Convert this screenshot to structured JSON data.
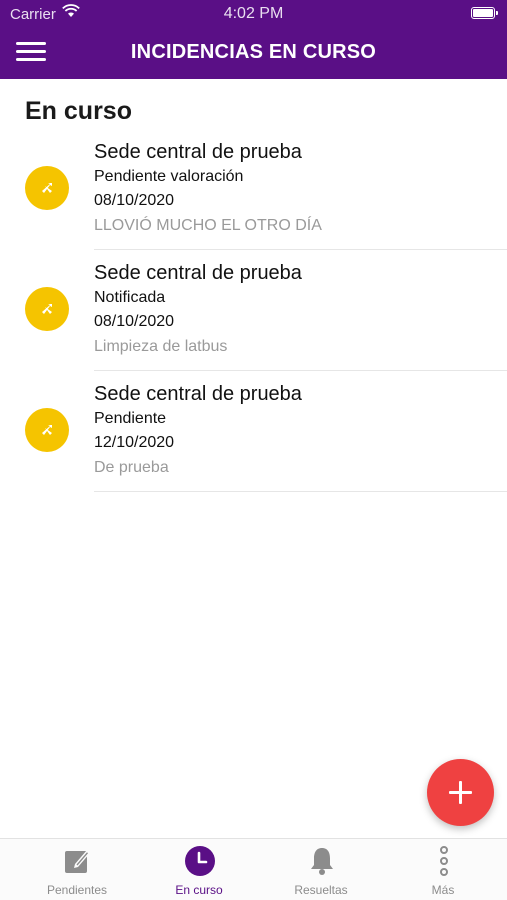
{
  "status_bar": {
    "carrier": "Carrier",
    "time": "4:02 PM"
  },
  "header": {
    "title": "INCIDENCIAS EN CURSO",
    "menu_icon": "hamburger-menu-icon"
  },
  "section": {
    "title": "En curso"
  },
  "incidents": [
    {
      "site": "Sede central de prueba",
      "status": "Pendiente valoración",
      "date": "08/10/2020",
      "description": "LLOVIÓ MUCHO EL OTRO DÍA",
      "icon": "tools-icon"
    },
    {
      "site": "Sede central de prueba",
      "status": "Notificada",
      "date": "08/10/2020",
      "description": "Limpieza de latbus",
      "icon": "tools-icon"
    },
    {
      "site": "Sede central de prueba",
      "status": "Pendiente",
      "date": "12/10/2020",
      "description": "De prueba",
      "icon": "tools-icon"
    }
  ],
  "fab": {
    "icon": "plus-icon"
  },
  "tabs": [
    {
      "label": "Pendientes",
      "icon": "edit-note-icon",
      "active": false
    },
    {
      "label": "En curso",
      "icon": "clock-icon",
      "active": true
    },
    {
      "label": "Resueltas",
      "icon": "bell-icon",
      "active": false
    },
    {
      "label": "Más",
      "icon": "more-vertical-icon",
      "active": false
    }
  ],
  "colors": {
    "brand": "#5a0f86",
    "avatar": "#f5c400",
    "fab": "#ef4141",
    "muted": "#9a9a9a"
  }
}
